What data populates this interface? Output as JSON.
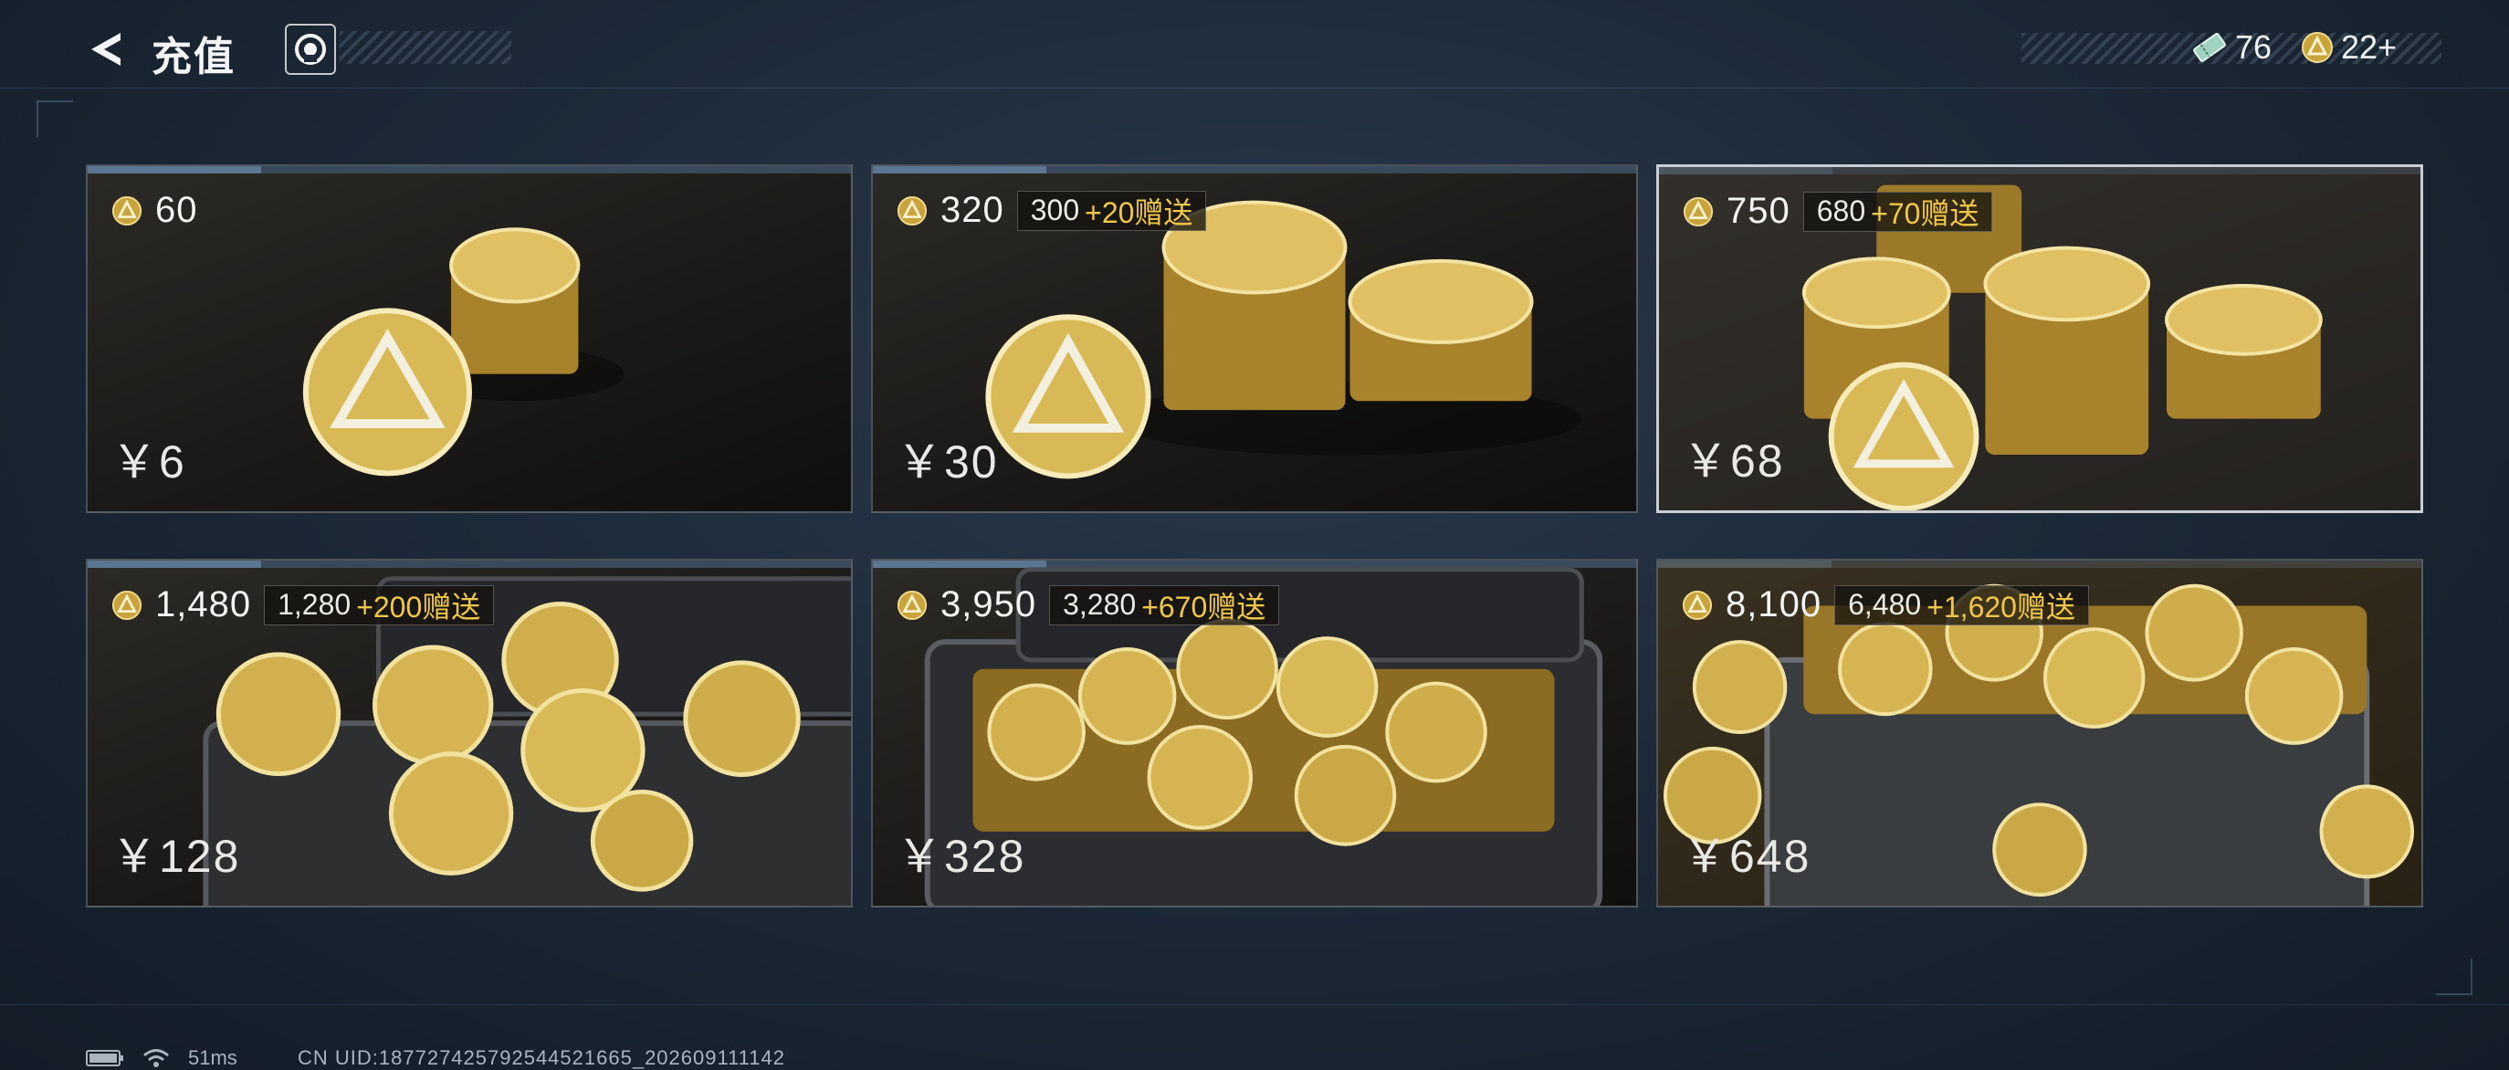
{
  "header": {
    "title": "充值",
    "tickets_count": "76",
    "coins_count": "22+"
  },
  "colors": {
    "gift_text": "#f1c74a",
    "coin_gold": "#c9a33c",
    "background": "#1d2a39"
  },
  "icons": {
    "back": "back-arrow-icon",
    "service": "customer-service-icon",
    "ticket": "ticket-icon",
    "coin": "coin-icon",
    "battery": "battery-icon",
    "wifi": "wifi-icon"
  },
  "packages": [
    {
      "amount": "60",
      "bonus_base": "",
      "bonus_extra": "",
      "price": "￥6"
    },
    {
      "amount": "320",
      "bonus_base": "300",
      "bonus_extra": "+20赠送",
      "price": "￥30"
    },
    {
      "amount": "750",
      "bonus_base": "680",
      "bonus_extra": "+70赠送",
      "price": "￥68"
    },
    {
      "amount": "1,480",
      "bonus_base": "1,280",
      "bonus_extra": "+200赠送",
      "price": "￥128"
    },
    {
      "amount": "3,950",
      "bonus_base": "3,280",
      "bonus_extra": "+670赠送",
      "price": "￥328"
    },
    {
      "amount": "8,100",
      "bonus_base": "6,480",
      "bonus_extra": "+1,620赠送",
      "price": "￥648"
    }
  ],
  "status_bar": {
    "ping": "51ms",
    "uid": "CN UID:18772742579254452​1665_202609111142"
  }
}
